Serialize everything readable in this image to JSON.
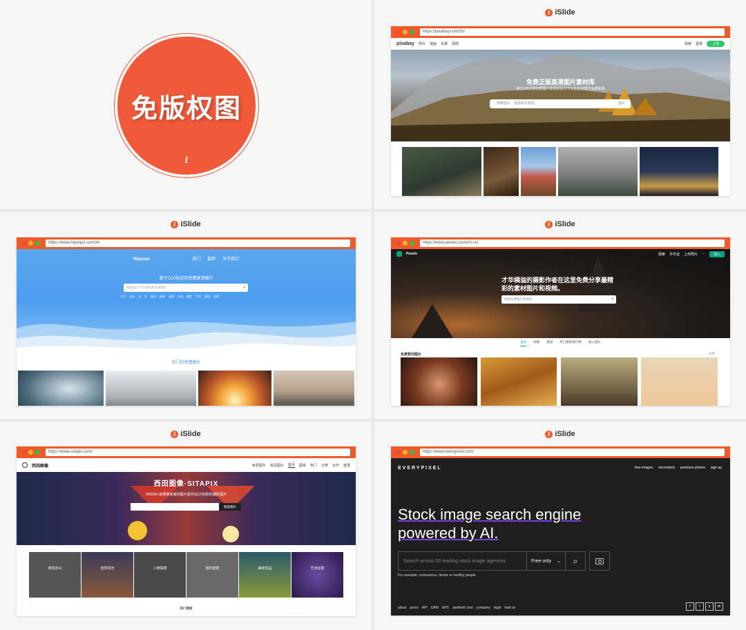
{
  "brand": "iSlide",
  "cover": {
    "title": "免版权图",
    "mark": "i"
  },
  "pixabay": {
    "url": "https://pixabay.com/zh/",
    "logo": "pixabay",
    "nav": [
      "照片",
      "插画",
      "矢量",
      "视频"
    ],
    "nav_right": [
      "探索",
      "登录",
      "上传"
    ],
    "headline": "免费正版高清图片素材库",
    "sub": "超过180万张优质图片和视频素材可以在任何地方免费使用",
    "search_placeholder": "搜索图片、插画和矢量图",
    "search_scope": "图片"
  },
  "hippopx": {
    "url": "https://www.hippopx.com/zh",
    "logo": "Hippopx",
    "nav": [
      "热门",
      "最新",
      "关于我们"
    ],
    "headline": "基于CC0协议的免费高清图片",
    "search_placeholder": "搜索超过千万张免费高清图片",
    "tags": [
      "天空",
      "大海",
      "山",
      "花",
      "城市",
      "森林",
      "动物",
      "人物",
      "美食",
      "汽车",
      "建筑",
      "自然"
    ],
    "section": "热门的免费图片"
  },
  "pexels": {
    "url": "https://www.pexels.com/zh-cn/",
    "logo": "Pexels",
    "nav": [
      "探索",
      "许可证",
      "上传照片"
    ],
    "join": "加入",
    "headline": "才华横溢的摄影作者在这里免费分享最精彩的素材图片和视频。",
    "search_placeholder": "搜索免费图片和视频",
    "tabs": [
      "主页",
      "视频",
      "挑战",
      "热门搜索排行榜",
      "加入团队"
    ],
    "section": "免费素材图片",
    "sort": "人气"
  },
  "sitapix": {
    "url": "https://www.sitapix.com/",
    "logo": "西田图像",
    "nav": [
      "免费图片",
      "高清图片",
      "首页",
      "图库",
      "热门",
      "分类",
      "合作",
      "登录"
    ],
    "headline": "西田图像·SITAPIX",
    "sub": "200000+高质量免版权图片素材|设计师素材|摄影图片",
    "search_button": "搜索图片",
    "categories": [
      {
        "title": "商务办公"
      },
      {
        "title": "自然风光"
      },
      {
        "title": "人物情感"
      },
      {
        "title": "城市建筑"
      },
      {
        "title": "美食饮品"
      },
      {
        "title": "艺术创意"
      }
    ],
    "footer_label": "热门搜索"
  },
  "everypixel": {
    "url": "https://www.everypixel.com/",
    "logo": "EVERYPIXEL",
    "nav": [
      "free images",
      "microstock",
      "premium photos",
      "sign up"
    ],
    "headline_line1": "Stock image search engine",
    "headline_line2": "powered by AI.",
    "search_placeholder": "Search across 50 leading stock image agencies",
    "filter": "Free only",
    "example": "For example: coronavirus, doctor or healthy people",
    "footer_links": [
      "about",
      "press",
      "API",
      "DAM",
      "EPX",
      "aesthetic test",
      "company",
      "legal",
      "mail us"
    ],
    "social": [
      "f",
      "t",
      "p",
      "vk"
    ]
  },
  "colors": {
    "accent": "#f0592a",
    "everypixel_bg": "#1e1e1e",
    "underline": "#7b3fe4"
  }
}
